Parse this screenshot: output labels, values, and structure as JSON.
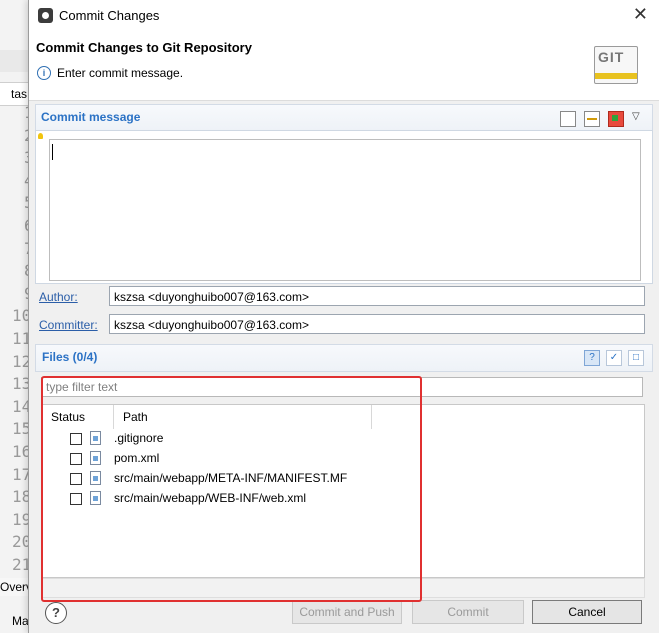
{
  "background_ide": {
    "tab_label": "tas",
    "line_numbers": [
      "1",
      "2",
      "3",
      "4",
      "5",
      "6",
      "7",
      "8",
      "9",
      "10",
      "11",
      "12",
      "13",
      "14",
      "15",
      "16",
      "17",
      "18",
      "19",
      "20",
      "21"
    ],
    "overview_label": "Overv",
    "bottom_tab_label": "Ma"
  },
  "dialog": {
    "window_title": "Commit Changes",
    "heading": "Commit Changes to Git Repository",
    "info_message": "Enter commit message.",
    "logo_text": "GIT",
    "commit_message": {
      "section_title": "Commit message",
      "value": ""
    },
    "author": {
      "label": "Author:",
      "value": "kszsa <duyonghuibo007@163.com>"
    },
    "committer": {
      "label": "Committer:",
      "value": "kszsa <duyonghuibo007@163.com>"
    },
    "files": {
      "section_title": "Files (0/4)",
      "filter_placeholder": "type filter text",
      "columns": [
        "Status",
        "Path"
      ],
      "rows": [
        {
          "path": ".gitignore",
          "checked": false
        },
        {
          "path": "pom.xml",
          "checked": false
        },
        {
          "path": "src/main/webapp/META-INF/MANIFEST.MF",
          "checked": false
        },
        {
          "path": "src/main/webapp/WEB-INF/web.xml",
          "checked": false
        }
      ]
    },
    "buttons": {
      "commit_and_push": "Commit and Push",
      "commit": "Commit",
      "cancel": "Cancel"
    }
  },
  "colors": {
    "section_title": "#2b72c5",
    "highlight_box": "#e03030"
  }
}
